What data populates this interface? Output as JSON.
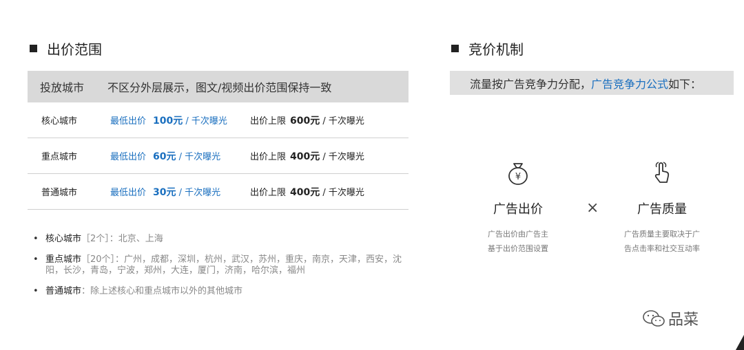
{
  "left": {
    "title": "出价范围",
    "table": {
      "header": {
        "city": "投放城市",
        "desc": "不区分外层展示，图文/视频出价范围保持一致"
      },
      "rows": [
        {
          "city": "核心城市",
          "min_label": "最低出价",
          "min_value": "100元",
          "min_unit": " / 千次曝光",
          "max_label": "出价上限",
          "max_value": "600元",
          "max_unit": " / 千次曝光"
        },
        {
          "city": "重点城市",
          "min_label": "最低出价",
          "min_value": "60元",
          "min_unit": " / 千次曝光",
          "max_label": "出价上限",
          "max_value": "400元",
          "max_unit": " / 千次曝光"
        },
        {
          "city": "普通城市",
          "min_label": "最低出价",
          "min_value": "30元",
          "min_unit": " / 千次曝光",
          "max_label": "出价上限",
          "max_value": "400元",
          "max_unit": " / 千次曝光"
        }
      ]
    },
    "bullets": [
      {
        "name": "核心城市",
        "text": "［2个］：北京、上海"
      },
      {
        "name": "重点城市",
        "text": "［20个］：广州，成都，深圳，杭州，武汉，苏州，重庆，南京，天津，西安，沈阳，长沙，青岛，宁波，郑州，大连，厦门，济南，哈尔滨，福州"
      },
      {
        "name": "普通城市",
        "text": "：除上述核心和重点城市以外的其他城市"
      }
    ]
  },
  "right": {
    "title": "竞价机制",
    "bar": {
      "text_before": "流量按广告竞争力分配，",
      "link": "广告竞争力公式",
      "text_after": "如下："
    },
    "factors": [
      {
        "icon": "money-bag-icon",
        "title": "广告出价",
        "desc_line1": "广告出价由广告主",
        "desc_line2": "基于出价范围设置"
      },
      {
        "icon": "pointer-hand-icon",
        "title": "广告质量",
        "desc_line1": "广告质量主要取决于广",
        "desc_line2": "告点击率和社交互动率"
      }
    ],
    "operator": "×"
  },
  "watermark": {
    "icon": "wechat-icon",
    "text": "品菜"
  },
  "colors": {
    "accent": "#1a6fbf",
    "header_bg": "#d9d9d9",
    "bar_bg": "#e0e0e0"
  }
}
